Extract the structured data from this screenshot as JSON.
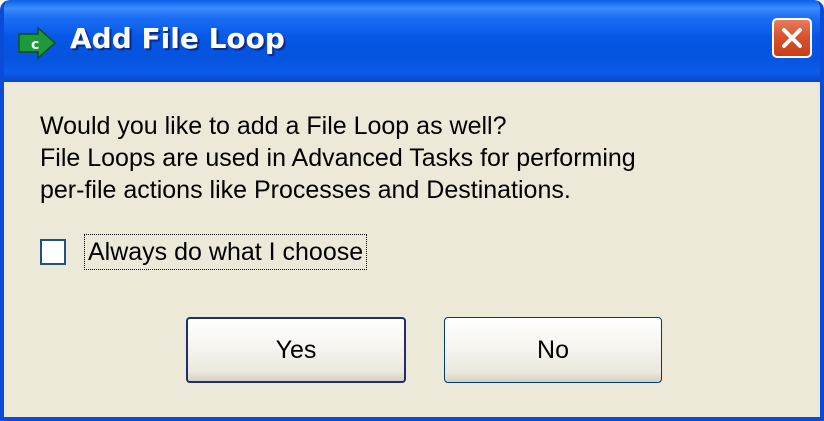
{
  "window": {
    "title": "Add File Loop",
    "icon": "green-arrow-c-icon",
    "close_icon": "close-x-icon"
  },
  "message": {
    "lines": [
      "Would you like to add a File Loop as well?",
      "File Loops are used in Advanced Tasks for performing",
      "per-file actions like Processes and Destinations."
    ]
  },
  "checkbox": {
    "label": "Always do what I choose",
    "checked": false
  },
  "buttons": {
    "yes": "Yes",
    "no": "No"
  },
  "colors": {
    "titlebar": "#0757e6",
    "dialog_background": "#ece9d8",
    "close_button": "#d9532e",
    "icon_green": "#1f9a3a"
  }
}
